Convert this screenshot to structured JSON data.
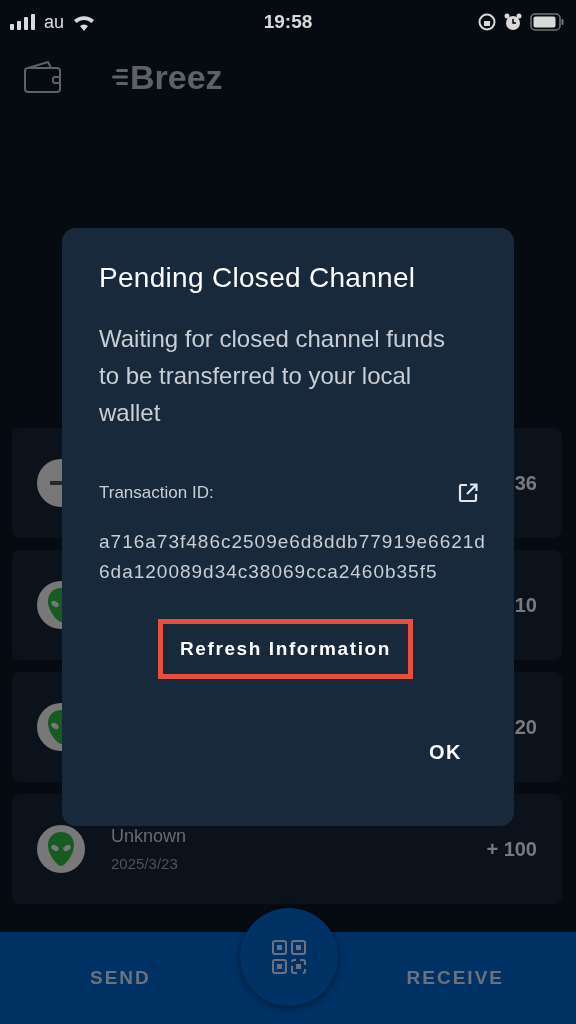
{
  "status_bar": {
    "carrier": "au",
    "time": "19:58"
  },
  "header": {
    "logo": "Breez"
  },
  "transactions": [
    {
      "kind": "closed",
      "amount": "36"
    },
    {
      "kind": "alien",
      "amount": "10"
    },
    {
      "kind": "alien",
      "amount": "20"
    },
    {
      "kind": "alien",
      "title": "Unknown",
      "date": "2025/3/23",
      "amount": "+ 100"
    }
  ],
  "dialog": {
    "title": "Pending Closed Channel",
    "message": "Waiting for closed channel funds to be transferred to your local wallet",
    "tx_label": "Transaction ID:",
    "tx_id": "a716a73f486c2509e6d8ddb77919e6621d6da120089d34c38069cca2460b35f5",
    "refresh_button": {
      "label": "Refresh Information",
      "highlighted": true
    },
    "ok_button": "OK"
  },
  "bottom_nav": {
    "send": "SEND",
    "receive": "RECEIVE"
  }
}
